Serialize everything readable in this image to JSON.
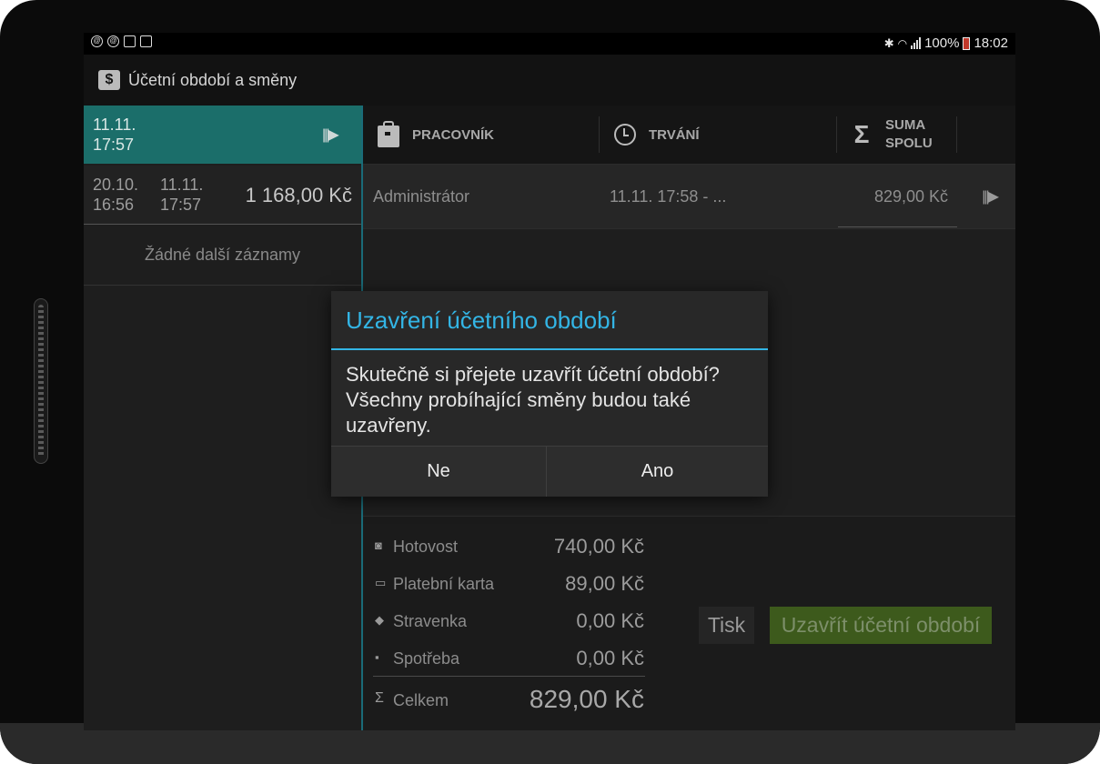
{
  "status_bar": {
    "battery": "100%",
    "time": "18:02"
  },
  "action_bar": {
    "title": "Účetní období a směny",
    "icon": "money-icon"
  },
  "periods": {
    "active": {
      "line1": "11.11.",
      "line2": "17:57"
    },
    "items": [
      {
        "start_date": "20.10.",
        "start_time": "16:56",
        "end_date": "11.11.",
        "end_time": "17:57",
        "amount": "1 168,00 Kč"
      }
    ],
    "no_more": "Žádné další záznamy"
  },
  "table": {
    "headers": {
      "worker": "PRACOVNÍK",
      "duration": "TRVÁNÍ",
      "sum_line1": "SUMA",
      "sum_line2": "SPOLU"
    },
    "rows": [
      {
        "worker": "Administrátor",
        "duration": "11.11. 17:58 - ...",
        "sum": "829,00 Kč"
      }
    ]
  },
  "summary": {
    "cash": {
      "label": "Hotovost",
      "value": "740,00 Kč"
    },
    "card": {
      "label": "Platební karta",
      "value": "89,00 Kč"
    },
    "voucher": {
      "label": "Stravenka",
      "value": "0,00 Kč"
    },
    "consumption": {
      "label": "Spotřeba",
      "value": "0,00 Kč"
    },
    "total": {
      "label": "Celkem",
      "value": "829,00 Kč"
    }
  },
  "actions": {
    "print": "Tisk",
    "close_period": "Uzavřít účetní období"
  },
  "dialog": {
    "title": "Uzavření účetního období",
    "message": "Skutečně si přejete uzavřít účetní období? Všechny probíhající směny budou také uzavřeny.",
    "no": "Ne",
    "yes": "Ano"
  },
  "colors": {
    "accent": "#33b5e5",
    "active_period": "#1b6e6a",
    "close_button": "#3d5a1c"
  }
}
